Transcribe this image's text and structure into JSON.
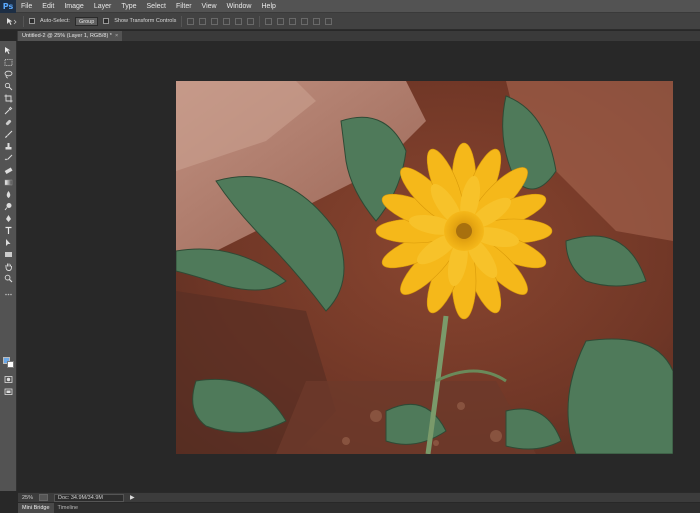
{
  "app": {
    "logo": "Ps",
    "menu": [
      "File",
      "Edit",
      "Image",
      "Layer",
      "Type",
      "Select",
      "Filter",
      "View",
      "Window",
      "Help"
    ]
  },
  "options": {
    "tool_icon": "move-tool",
    "auto_select_label": "Auto-Select:",
    "auto_select_value": "Group",
    "transform_label": "Show Transform Controls"
  },
  "document": {
    "tab_title": "Untitled-2 @ 25% (Layer 1, RGB/8) *",
    "close": "×"
  },
  "status": {
    "zoom": "25%",
    "doc_info": "Doc: 34.9M/34.9M",
    "arrow": "▶"
  },
  "bottom_tabs": [
    "Mini Bridge",
    "Timeline"
  ],
  "colors": {
    "foreground": "#6aa8e8",
    "background": "#ffffff",
    "petal": "#f5b81a"
  }
}
